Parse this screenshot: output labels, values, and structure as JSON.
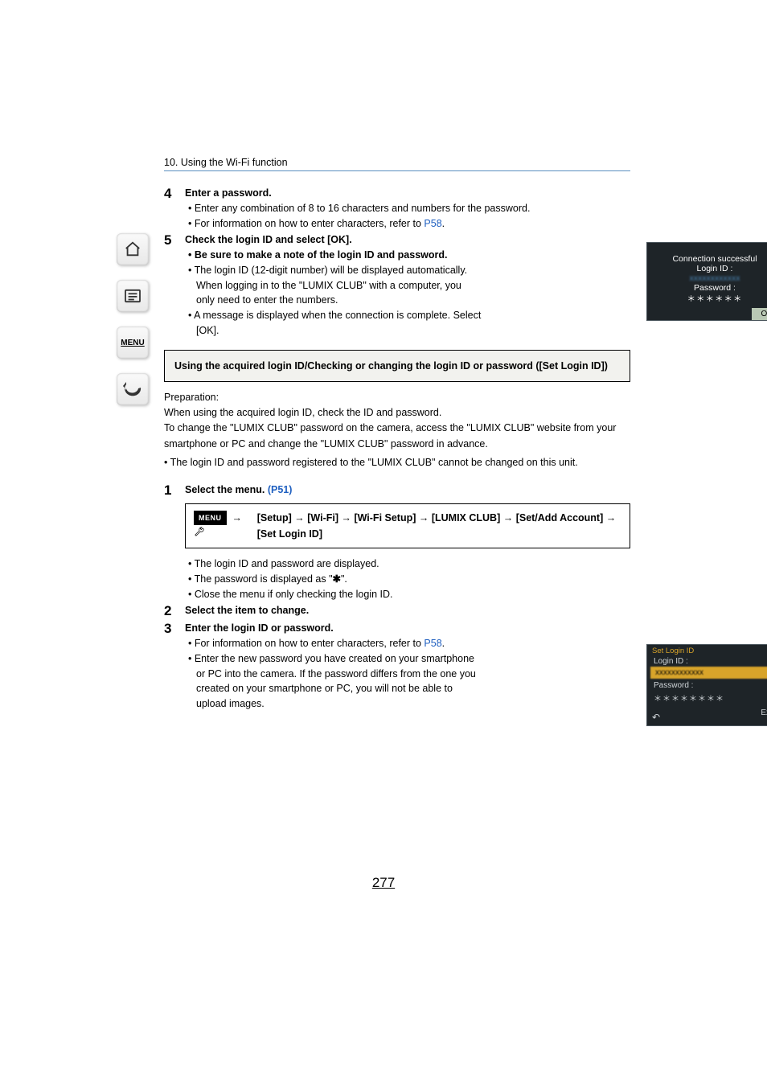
{
  "chapter_header": "10. Using the Wi-Fi function",
  "sidebar": {
    "home": "⌂",
    "toc": "≣",
    "menu": "MENU",
    "back": "↶"
  },
  "step4": {
    "num": "4",
    "title": "Enter a password.",
    "b1": "• Enter any combination of 8 to 16 characters and numbers for the password.",
    "b2a": "• For information on how to enter characters, refer to ",
    "b2_link": "P58",
    "b2b": "."
  },
  "step5": {
    "num": "5",
    "title": "Check the login ID and select [OK].",
    "b1": "• Be sure to make a note of the login ID and password.",
    "b2": "• The login ID (12-digit number) will be displayed automatically.",
    "b2_cont": "When logging in to the \"LUMIX CLUB\" with a computer, you only need to enter the numbers.",
    "b3": "• A message is displayed when the connection is complete. Select [OK]."
  },
  "ss1": {
    "line1": "Connection successful",
    "line2": "Login ID :",
    "login_id_masked": "xxxxxxxxxxxx",
    "line3": "Password :",
    "pwd_masked": "＊＊＊＊＊＊",
    "ok": "OK"
  },
  "callout": "Using the acquired login ID/Checking or changing the login ID or password ([Set Login ID])",
  "prep": {
    "p1": "Preparation:",
    "p2": "When using the acquired login ID, check the ID and password.",
    "p3": "To change the \"LUMIX CLUB\" password on the camera, access the \"LUMIX CLUB\" website from your smartphone or PC and change the \"LUMIX CLUB\" password in advance.",
    "p4": "• The login ID and password registered to the \"LUMIX CLUB\" cannot be changed on this unit."
  },
  "stepA1": {
    "num": "1",
    "title_a": "Select the menu. ",
    "title_link": "(P51)"
  },
  "menu_path": {
    "chip": "MENU",
    "arrow": "→",
    "path": "[Setup] → [Wi-Fi] → [Wi-Fi Setup] → [LUMIX CLUB] → [Set/Add Account] → [Set Login ID]"
  },
  "postmenu": {
    "b1": "• The login ID and password are displayed.",
    "b2a": "• The password is displayed as \"",
    "b2_star": "✱",
    "b2b": "\".",
    "b3": "• Close the menu if only checking the login ID."
  },
  "stepA2": {
    "num": "2",
    "title": "Select the item to change."
  },
  "stepA3": {
    "num": "3",
    "title": "Enter the login ID or password.",
    "b1a": "• For information on how to enter characters, refer to ",
    "b1_link": "P58",
    "b1b": ".",
    "b2": "• Enter the new password you have created on your smartphone or PC into the camera. If the password differs from the one you created on your smartphone or PC, you will not be able to upload images."
  },
  "ss2": {
    "hdr": "Set Login ID",
    "r1": "Login ID :",
    "sel_masked": "xxxxxxxxxxxx",
    "r2": "Password :",
    "pwd": "＊＊＊＊＊＊＊＊",
    "exit": "Exit",
    "back": "↶"
  },
  "page_number": "277"
}
